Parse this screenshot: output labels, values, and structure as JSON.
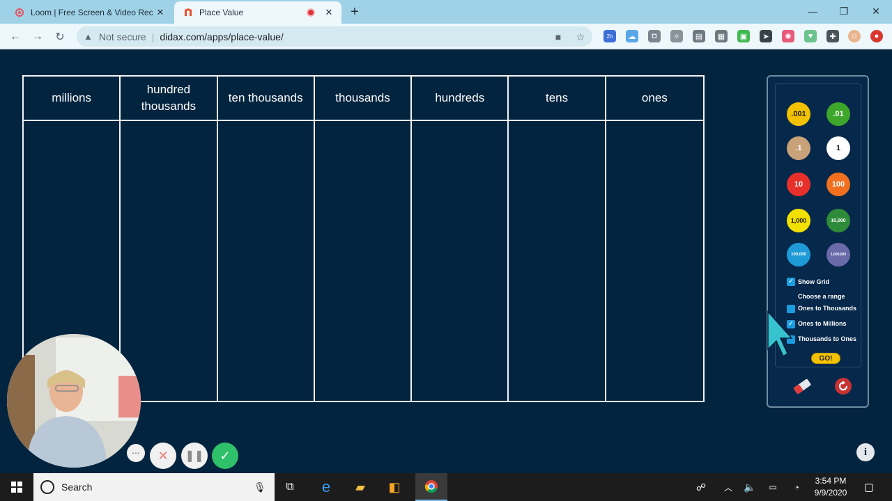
{
  "browser": {
    "tabs": [
      {
        "title": "Loom | Free Screen & Video Rec",
        "active": false
      },
      {
        "title": "Place Value",
        "active": true
      }
    ],
    "security_label": "Not secure",
    "url": "didax.com/apps/place-value/",
    "extension_badge": "2h"
  },
  "place_value": {
    "columns": [
      "millions",
      "hundred thousands",
      "ten thousands",
      "thousands",
      "hundreds",
      "tens",
      "ones"
    ]
  },
  "palette": {
    "disks": [
      {
        "label": ".001",
        "color": "#f2c200",
        "text_color": "#1a1a1a"
      },
      {
        "label": ".01",
        "color": "#3ea62b",
        "text_color": "#ffffff"
      },
      {
        "label": ".1",
        "color": "#c9a27a",
        "text_color": "#ffffff"
      },
      {
        "label": "1",
        "color": "#ffffff",
        "text_color": "#1a1a1a"
      },
      {
        "label": "10",
        "color": "#e8302a",
        "text_color": "#ffffff"
      },
      {
        "label": "100",
        "color": "#f07020",
        "text_color": "#ffffff"
      },
      {
        "label": "1,000",
        "color": "#f2e000",
        "text_color": "#1a1a1a"
      },
      {
        "label": "10,000",
        "color": "#2e8b3a",
        "text_color": "#ffffff"
      },
      {
        "label": "100,000",
        "color": "#1e9ad6",
        "text_color": "#ffffff"
      },
      {
        "label": "1,000,000",
        "color": "#6a6aa8",
        "text_color": "#ffffff"
      }
    ],
    "show_grid_label": "Show Grid",
    "show_grid_checked": true,
    "choose_range_label": "Choose a range",
    "ranges": [
      {
        "label": "Ones to Thousands",
        "checked": false
      },
      {
        "label": "Ones to Millions",
        "checked": true
      },
      {
        "label": "Thousands to Ones",
        "checked": false
      }
    ],
    "go_label": "GO!"
  },
  "taskbar": {
    "search_placeholder": "Search",
    "time": "3:54 PM",
    "date": "9/9/2020"
  }
}
